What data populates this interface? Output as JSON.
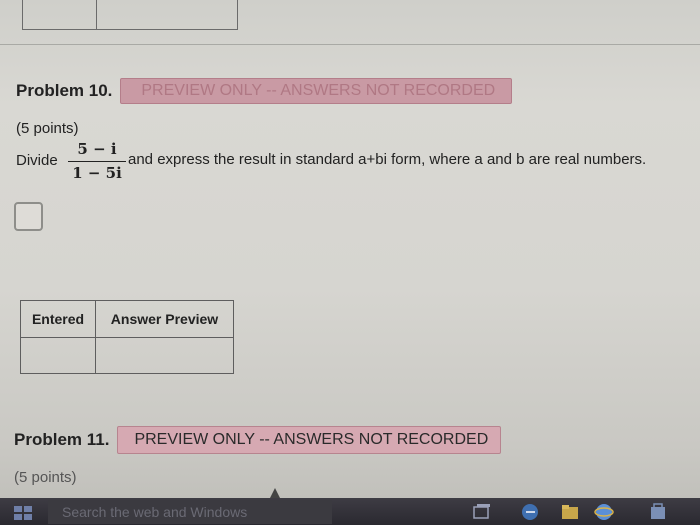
{
  "problem10": {
    "title": "Problem 10.",
    "banner": "PREVIEW ONLY -- ANSWERS NOT RECORDED",
    "points": "(5 points)",
    "divide_label": "Divide",
    "numerator": "5 − i",
    "denominator": "1 − 5i",
    "instruction": "and express the result in standard a+bi form, where a and b are real numbers."
  },
  "results_table": {
    "headers": [
      "Entered",
      "Answer Preview"
    ],
    "rows": [
      [
        "",
        ""
      ]
    ]
  },
  "problem11": {
    "title": "Problem 11.",
    "banner": "PREVIEW ONLY -- ANSWERS NOT RECORDED",
    "points": "(5 points)"
  },
  "taskbar": {
    "search_placeholder": "Search the web and Windows",
    "icons": [
      "windows-start-icon",
      "task-view-icon",
      "edge-icon",
      "file-explorer-icon",
      "store-icon"
    ]
  },
  "colors": {
    "banner_bg": "#c99aa4",
    "taskbar_bg": "#2a2930",
    "page_bg": "#d6d5d0"
  }
}
